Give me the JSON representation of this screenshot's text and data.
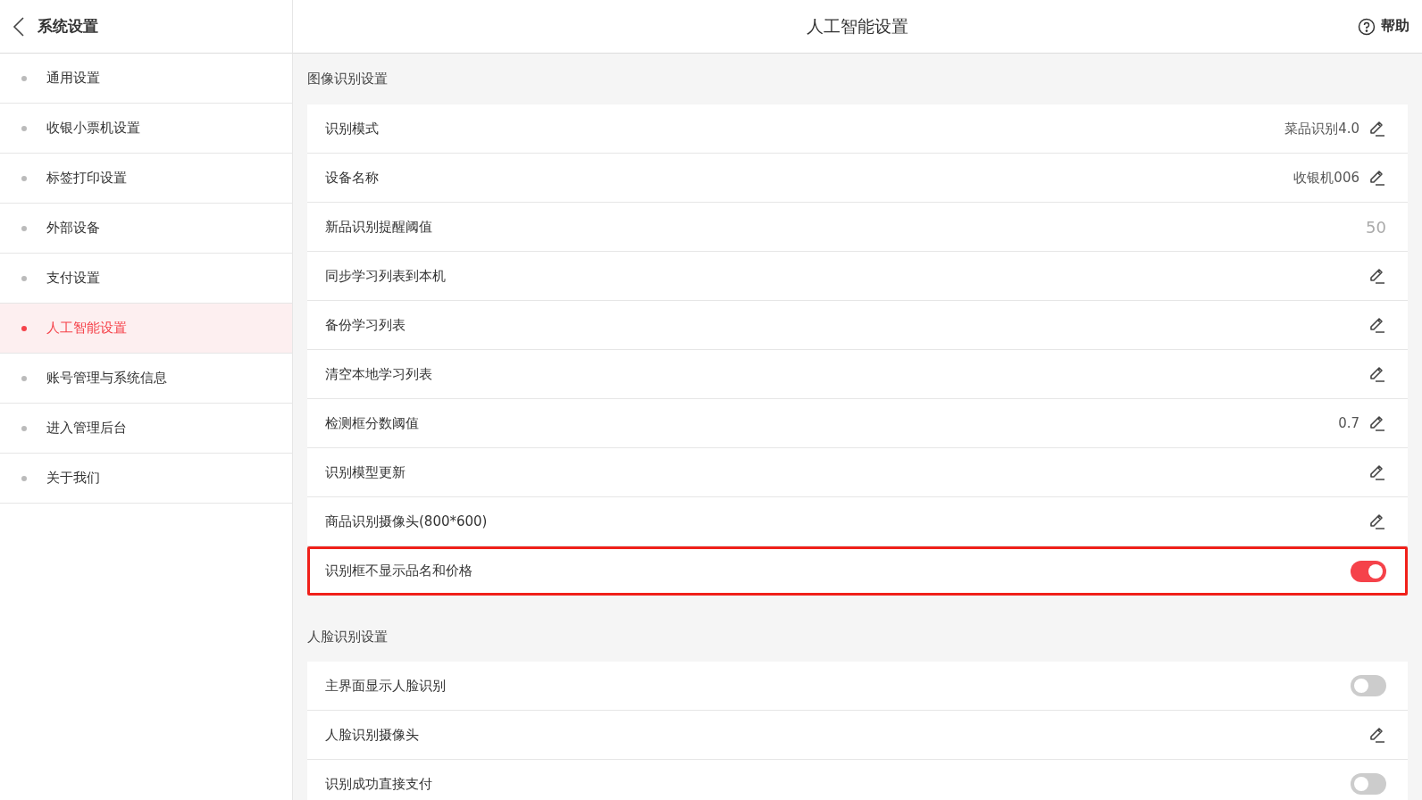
{
  "sidebar": {
    "title": "系统设置",
    "items": [
      {
        "label": "通用设置",
        "selected": false
      },
      {
        "label": "收银小票机设置",
        "selected": false
      },
      {
        "label": "标签打印设置",
        "selected": false
      },
      {
        "label": "外部设备",
        "selected": false
      },
      {
        "label": "支付设置",
        "selected": false
      },
      {
        "label": "人工智能设置",
        "selected": true
      },
      {
        "label": "账号管理与系统信息",
        "selected": false
      },
      {
        "label": "进入管理后台",
        "selected": false
      },
      {
        "label": "关于我们",
        "selected": false
      }
    ]
  },
  "header": {
    "title": "人工智能设置",
    "help": "帮助"
  },
  "sections": [
    {
      "title": "图像识别设置",
      "rows": [
        {
          "kind": "edit",
          "label": "识别模式",
          "value": "菜品识别4.0",
          "highlighted": false
        },
        {
          "kind": "edit",
          "label": "设备名称",
          "value": "收银机006",
          "highlighted": false
        },
        {
          "kind": "value",
          "label": "新品识别提醒阈值",
          "value": "50",
          "highlighted": false
        },
        {
          "kind": "edit",
          "label": "同步学习列表到本机",
          "highlighted": false
        },
        {
          "kind": "edit",
          "label": "备份学习列表",
          "highlighted": false
        },
        {
          "kind": "edit",
          "label": "清空本地学习列表",
          "highlighted": false
        },
        {
          "kind": "edit",
          "label": "检测框分数阈值",
          "value": "0.7",
          "highlighted": false
        },
        {
          "kind": "edit",
          "label": "识别模型更新",
          "highlighted": false
        },
        {
          "kind": "edit",
          "label": "商品识别摄像头(800*600)",
          "highlighted": false
        },
        {
          "kind": "toggle",
          "label": "识别框不显示品名和价格",
          "on": true,
          "highlighted": true
        }
      ]
    },
    {
      "title": "人脸识别设置",
      "rows": [
        {
          "kind": "toggle",
          "label": "主界面显示人脸识别",
          "on": false,
          "highlighted": false
        },
        {
          "kind": "edit",
          "label": "人脸识别摄像头",
          "highlighted": false
        },
        {
          "kind": "toggle",
          "label": "识别成功直接支付",
          "on": false,
          "highlighted": false
        }
      ]
    }
  ]
}
